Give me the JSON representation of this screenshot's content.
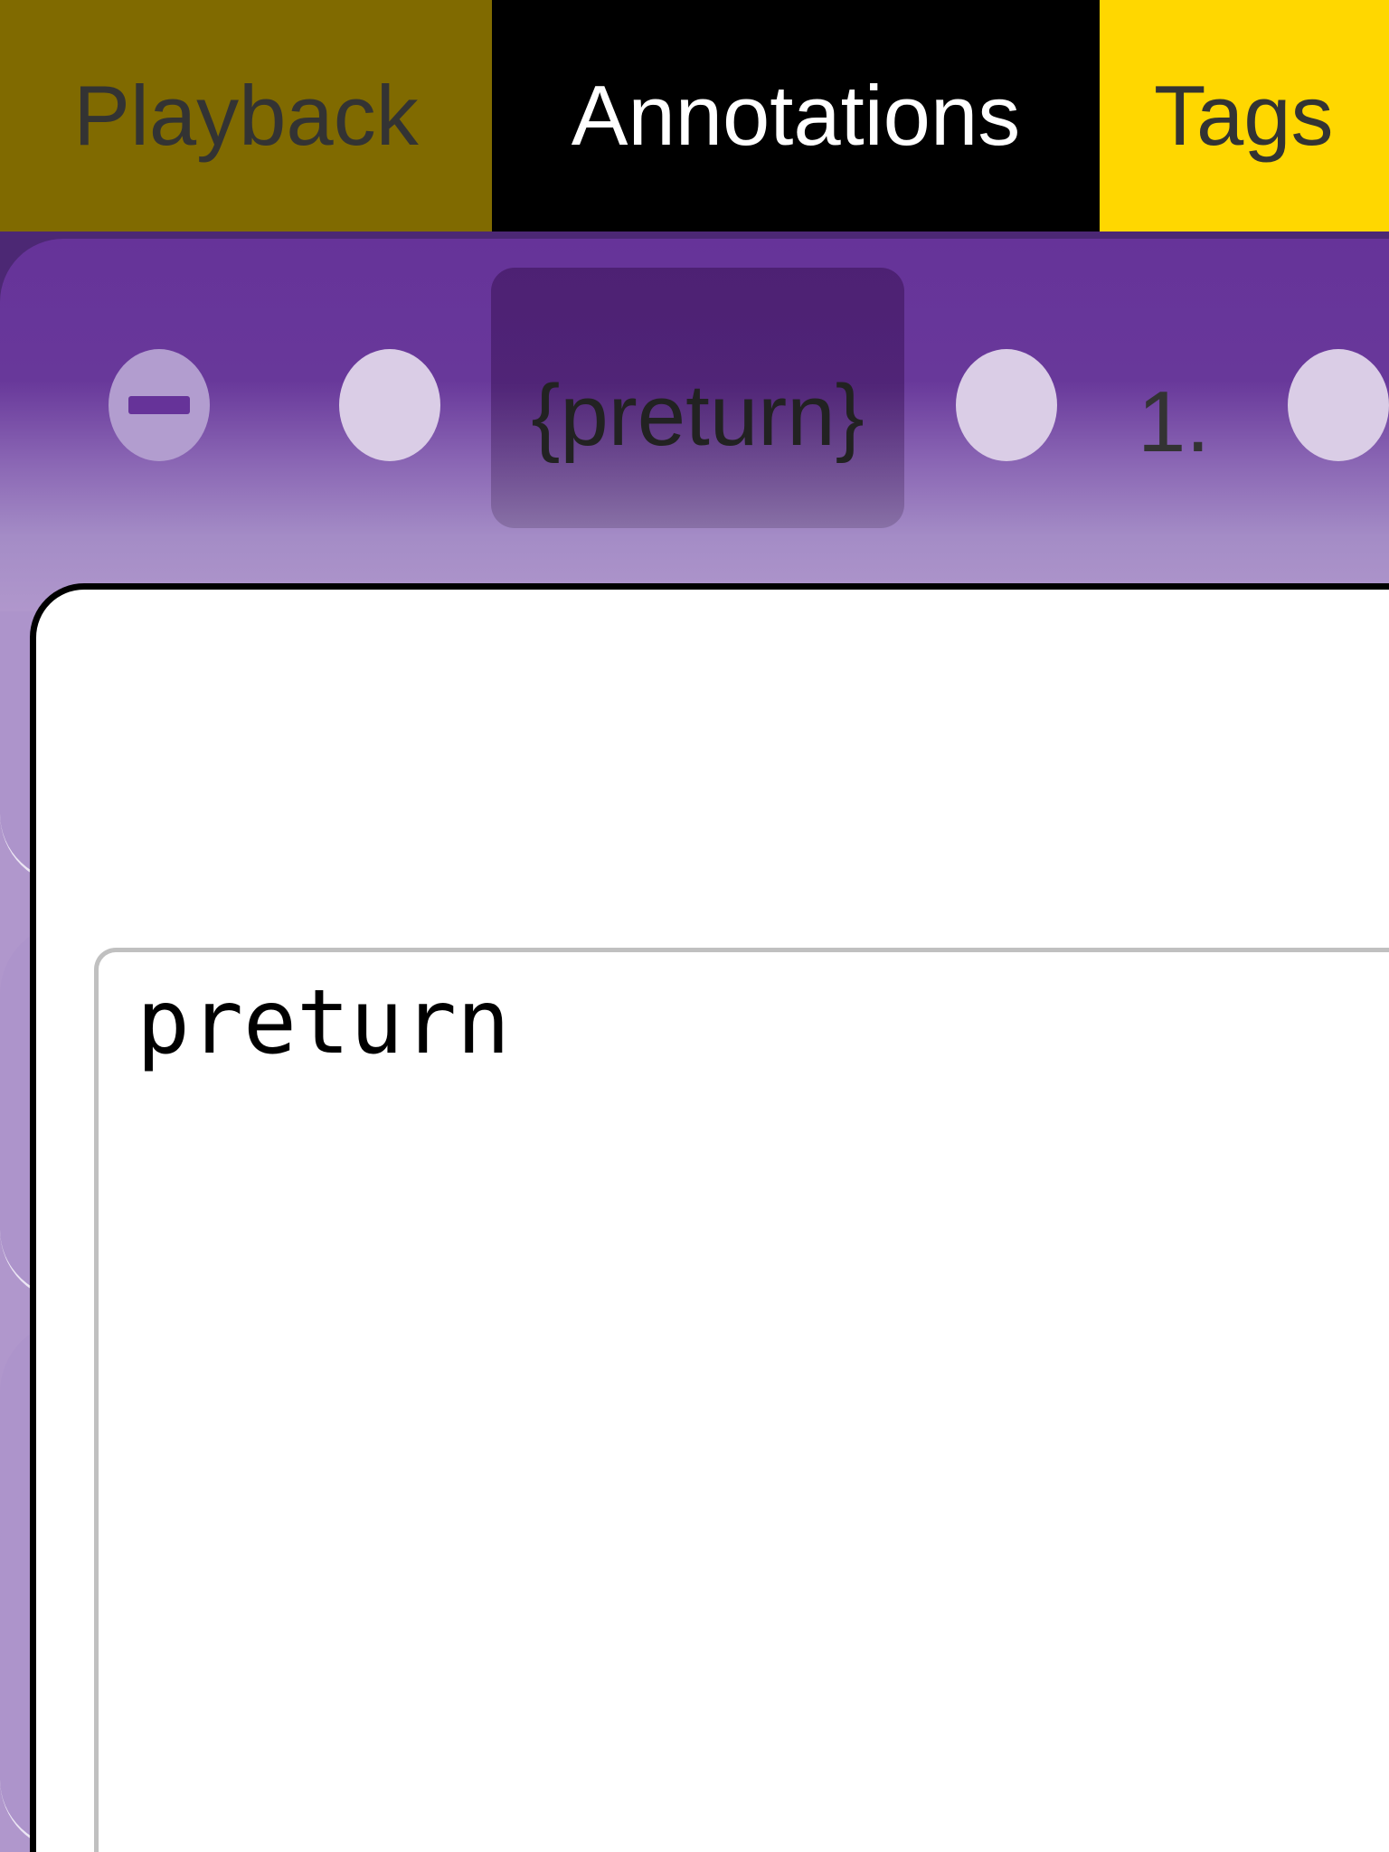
{
  "tabs": [
    {
      "label": "Playback",
      "color": "#806a00"
    },
    {
      "label": "Annotations",
      "color": "#000000",
      "active": true
    },
    {
      "label": "Tags",
      "color": "#ffd700"
    }
  ],
  "toolbar": {
    "token_label": "{preturn}",
    "number_label": "1.",
    "accent": "#663399"
  },
  "editor": {
    "value": "preturn"
  }
}
